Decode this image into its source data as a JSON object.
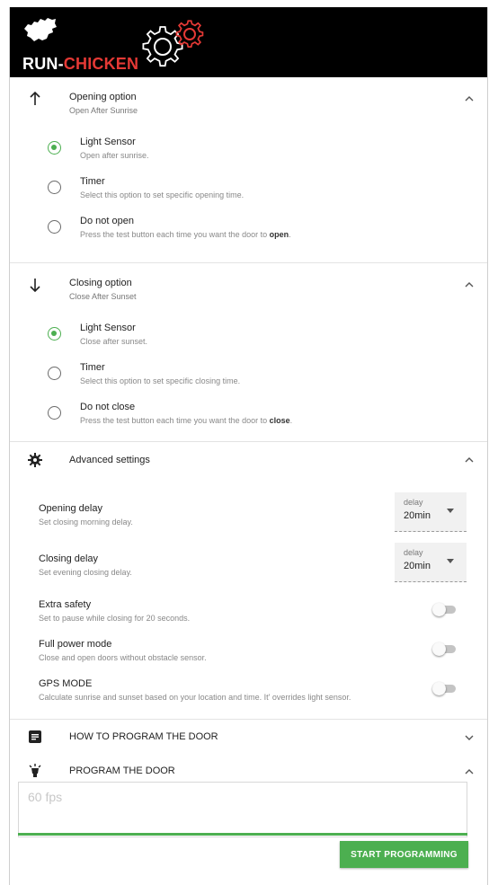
{
  "app": {
    "brand_part1": "RUN-",
    "brand_part2": "CHICKEN",
    "accent_color": "#4caf50",
    "brand_red": "#e53935"
  },
  "opening": {
    "icon": "arrow-up-icon",
    "title": "Opening option",
    "subtitle": "Open After Sunrise",
    "options": [
      {
        "title": "Light Sensor",
        "subtitle": "Open after sunrise.",
        "checked": true
      },
      {
        "title": "Timer",
        "subtitle": "Select this option to set specific opening time.",
        "checked": false
      },
      {
        "title": "Do not open",
        "subtitle_prefix": "Press the test button each time you want the door to ",
        "subtitle_bold": "open",
        "subtitle_suffix": ".",
        "checked": false
      }
    ]
  },
  "closing": {
    "icon": "arrow-down-icon",
    "title": "Closing option",
    "subtitle": "Close After Sunset",
    "options": [
      {
        "title": "Light Sensor",
        "subtitle": "Close after sunset.",
        "checked": true
      },
      {
        "title": "Timer",
        "subtitle": "Select this option to set specific closing time.",
        "checked": false
      },
      {
        "title": "Do not close",
        "subtitle_prefix": "Press the test button each time you want the door to ",
        "subtitle_bold": "close",
        "subtitle_suffix": ".",
        "checked": false
      }
    ]
  },
  "advanced": {
    "icon": "gear-icon",
    "title": "Advanced settings",
    "opening_delay": {
      "title": "Opening delay",
      "subtitle": "Set closing morning delay.",
      "select_label": "delay",
      "select_value": "20min"
    },
    "closing_delay": {
      "title": "Closing delay",
      "subtitle": "Set evening closing delay.",
      "select_label": "delay",
      "select_value": "20min"
    },
    "extra_safety": {
      "title": "Extra safety",
      "subtitle": "Set to pause while closing for 20 seconds.",
      "on": false
    },
    "full_power": {
      "title": "Full power mode",
      "subtitle": "Close and open doors without obstacle sensor.",
      "on": false
    },
    "gps_mode": {
      "title": "GPS MODE",
      "subtitle": "Calculate sunrise and sunset based on your location and time. It' overrides light sensor.",
      "on": false
    }
  },
  "how_to": {
    "icon": "document-icon",
    "title": "HOW TO PROGRAM THE DOOR"
  },
  "program": {
    "icon": "lamp-icon",
    "title": "PROGRAM THE DOOR",
    "fps_text": "60 fps",
    "start_label": "START PROGRAMMING"
  }
}
